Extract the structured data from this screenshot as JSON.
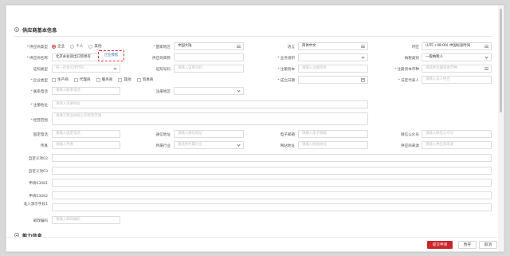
{
  "section1": {
    "title": "供应商基本信息"
  },
  "section2": {
    "title": "能力信息"
  },
  "row1": {
    "type_label": "供应商类型",
    "type_options": [
      "企业",
      "个人",
      "其他"
    ],
    "country_label": "国家地区",
    "country_value": "中国大陆",
    "lang_label": "语言",
    "lang_value": "简体中文",
    "tz_label": "时区",
    "tz_value": "(UTC+08:00) 中国标准时间"
  },
  "row2": {
    "name_label": "供应商名称",
    "name_value": "北京永益途出口贸易有",
    "badge": "企业模板",
    "short_label": "供应商简称",
    "org_label": "业务组织",
    "tax_label": "纳税类别",
    "tax_value": "一般纳税人"
  },
  "row3": {
    "cert_type_label": "证照类型",
    "cert_type_value": "统一社会信用代码",
    "cert_no_label": "证照号码",
    "cert_no_ph": "请输入证照号码",
    "capital_label": "注册资本",
    "capital_ph": "请输入注册资本",
    "currency_label": "注册资本币种",
    "currency_ph": "请选择注册资本币种"
  },
  "row4": {
    "nature_label": "企业类型",
    "nature_options": [
      "生产商",
      "代理商",
      "服务商",
      "其他",
      "贸易商"
    ],
    "found_label": "成立日期",
    "legal_label": "法定代表人",
    "legal_ph": "请输入法人姓名"
  },
  "row5": {
    "phone_label": "联系电话",
    "phone_ph": "请输入联系电话",
    "region_label": "注册地区"
  },
  "row6": {
    "addr_label": "注册地址",
    "addr_ph": "请输入注册地址"
  },
  "row7": {
    "scope_label": "经营范围",
    "scope_ph": "请填写营业执照上的经营范围"
  },
  "row8": {
    "fixed_label": "固定电话",
    "fixed_ph": "请输入固定电话",
    "comm_addr_label": "通信地址",
    "comm_addr_ph": "请输入通信地址",
    "email_label": "电子邮箱",
    "email_ph": "请输入电子邮箱",
    "wechat_label": "微信公众号",
    "wechat_ph": "请输入微信公众号"
  },
  "row9": {
    "fax_label": "传真",
    "fax_ph": "请输入传真",
    "industry_label": "所属行业",
    "industry_ph": "请选择所属行业",
    "site_label": "网站地址",
    "site_ph": "请输入网站地址",
    "source_label": "供应商来源",
    "source_ph": "请输入供应商来源"
  },
  "custom": {
    "c02_label": "自定义项02",
    "c03_label": "自定义项03",
    "p1_label": "申请03081",
    "p2_label": "申请03082",
    "p3_label": "准入演示字段1",
    "postal_label": "邮政编码",
    "postal_ph": "请输入邮政编码"
  },
  "footer": {
    "submit_label": "提交申请",
    "save_label": "暂存",
    "cancel_label": "取消"
  },
  "colors": {
    "accent": "#c8262c",
    "required": "#d23d3d",
    "link": "#3b76c9"
  }
}
